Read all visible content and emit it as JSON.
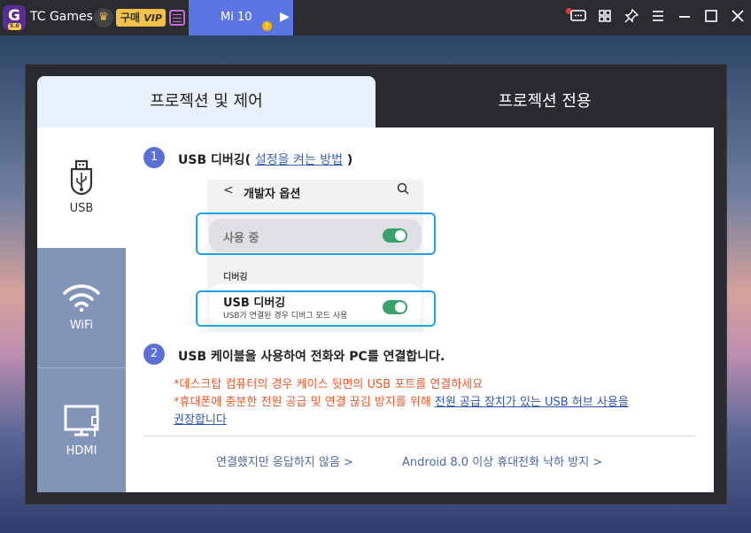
{
  "titlebar": {
    "app_logo": "G",
    "app_logo_version": "5.0",
    "app_name": "TC Games",
    "buy_label": "구매",
    "vip_label": "VIP",
    "device_tab": "Mi 10",
    "device_warning": "!",
    "crown_icon": "♛",
    "controls": [
      "message-icon",
      "layout-icon",
      "pin-icon",
      "menu-icon",
      "minimize-icon",
      "maximize-icon",
      "close-icon"
    ]
  },
  "tabs": {
    "active": "프로젝션 및 제어",
    "inactive": "프로젝션 전용"
  },
  "sidebar": {
    "items": [
      {
        "label": "USB",
        "icon": "usb-icon"
      },
      {
        "label": "WiFi",
        "icon": "wifi-icon"
      },
      {
        "label": "HDMI",
        "icon": "hdmi-icon"
      }
    ]
  },
  "steps": {
    "one": {
      "num": "1",
      "text_before": "USB 디버깅(",
      "link": "설정을 켜는 방법",
      "text_after": ")"
    },
    "two": {
      "num": "2",
      "text": "USB 케이블을 사용하여 전화와 PC를 연결합니다."
    }
  },
  "phone": {
    "title": "개발자 옵션",
    "in_use": "사용 중",
    "section": "디버깅",
    "usb_debug": "USB 디버깅",
    "usb_debug_sub": "USB가 연결된 경우 디버그 모드 사용"
  },
  "notes": {
    "line1": "*데스크탑 컴퓨터의 경우 케이스 뒷면의 USB 포트를 연결하세요",
    "line2_a": "*휴대폰에 충분한 전원 공급 및 연결 끊김 방지를 위해 ",
    "line2_link": "전원 공급 장치가 있는 USB 허브 사용을",
    "line3_link": "권장합니다"
  },
  "footer": {
    "link1": "연결했지만 응답하지 않음 >",
    "link2": "Android 8.0 이상 휴대전화 낙하 방지 >"
  },
  "colors": {
    "accent": "#5b76e2",
    "highlight": "#1fa3e6",
    "toggle": "#3aa36b",
    "note": "#e55b2d"
  }
}
